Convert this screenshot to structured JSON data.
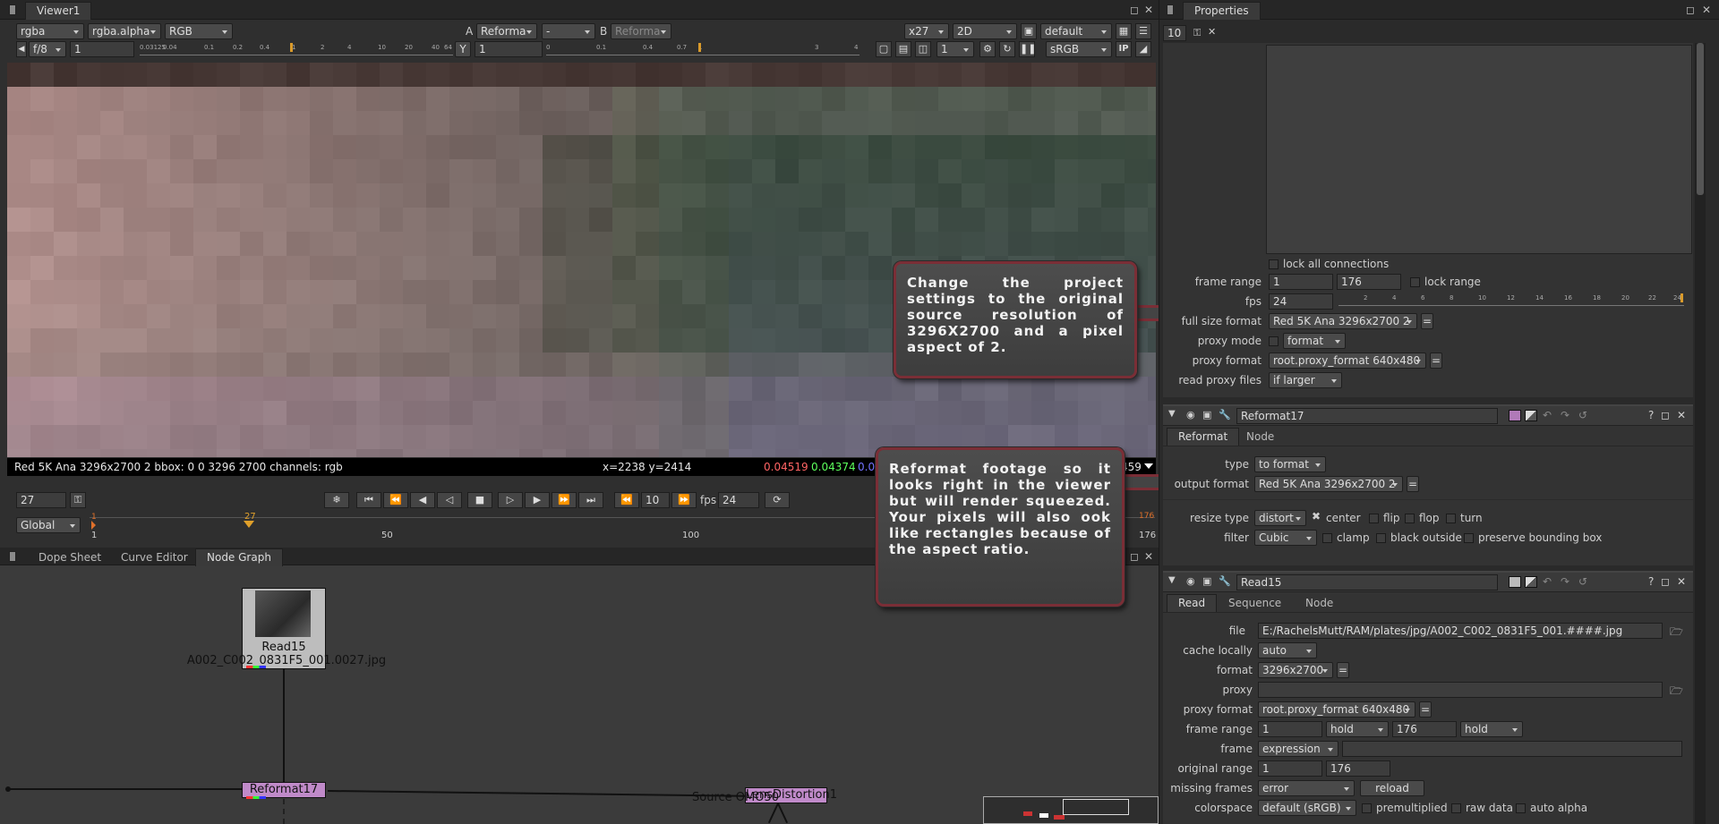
{
  "viewer": {
    "tab": "Viewer1",
    "channels": "rgba",
    "alpha": "rgba.alpha",
    "colorspace_mode": "RGB",
    "input_a_label": "A",
    "input_a": "Reforma",
    "input_a_op": "-",
    "input_b_label": "B",
    "input_b": "Reforma",
    "zoom": "x27",
    "view_mode": "2D",
    "lut_default": "default",
    "fstop": "f/8",
    "gain": "1",
    "gamma_label": "Y",
    "gamma": "1",
    "proxy_level": "1",
    "display": "sRGB",
    "ip_label": "IP",
    "gain_ticks": [
      "0.03125",
      "0.04",
      "0.1",
      "0.2",
      "0.4",
      "1",
      "2",
      "4",
      "10",
      "20",
      "40",
      "64"
    ],
    "gamma_ticks": [
      "0",
      "0.1",
      "0.4",
      "0.7",
      "1",
      "3",
      "4"
    ],
    "status_format": "Red 5K Ana 3296x2700 2  bbox: 0 0 3296 2700 channels: rgb",
    "status_coords": "x=2238 y=2414",
    "pixel_r": "0.04519",
    "pixel_g": "0.04374",
    "pixel_b": "0.05",
    "pixel_tail": "459",
    "colors": {
      "r": "#ff6464",
      "g": "#5dff5d",
      "b": "#7373ff"
    }
  },
  "timeline": {
    "frame": "27",
    "playback_step": "10",
    "fps_label": "fps",
    "fps": "24",
    "range_mode": "Global",
    "start_marker": "1",
    "current_marker": "27",
    "end_marker": "176",
    "ticks": [
      "1",
      "50",
      "100",
      "176"
    ]
  },
  "graph": {
    "tabs": [
      "Dope Sheet",
      "Curve Editor",
      "Node Graph"
    ],
    "read_node_title": "Read15",
    "read_node_file": "A002_C002_0831F5_001.0027.jpg",
    "reformat_node": "Reformat17",
    "lens_node": "LensDistortion1",
    "lens_overlay": "Source OMO50"
  },
  "callouts": {
    "project": "Change the project settings to the original source resolution of 3296X2700 and a pixel aspect of 2.",
    "reformat": "Reformat footage so it looks right in the viewer but will render squeezed. Your pixels will also ook like rectangles because of the aspect ratio."
  },
  "properties": {
    "tab": "Properties",
    "max_panels": "10",
    "project": {
      "lock_all": "lock all connections",
      "frame_range_label": "frame range",
      "frame_start": "1",
      "frame_end": "176",
      "lock_range": "lock range",
      "fps_label": "fps",
      "fps": "24",
      "fps_ticks": [
        "2",
        "4",
        "6",
        "8",
        "10",
        "12",
        "14",
        "16",
        "18",
        "20",
        "22",
        "24"
      ],
      "full_size_label": "full size format",
      "full_size": "Red 5K Ana 3296x2700 2",
      "proxy_mode_label": "proxy mode",
      "proxy_mode": "format",
      "proxy_format_label": "proxy format",
      "proxy_format": "root.proxy_format 640x480",
      "read_proxy_label": "read proxy files",
      "read_proxy": "if larger",
      "eq": "="
    },
    "reformat": {
      "name": "Reformat17",
      "tabs": [
        "Reformat",
        "Node"
      ],
      "type_label": "type",
      "type": "to format",
      "output_label": "output format",
      "output": "Red 5K Ana 3296x2700 2",
      "resize_label": "resize type",
      "resize": "distort",
      "center": "center",
      "flip": "flip",
      "flop": "flop",
      "turn": "turn",
      "filter_label": "filter",
      "filter": "Cubic",
      "clamp": "clamp",
      "black_outside": "black outside",
      "preserve_bbox": "preserve bounding box"
    },
    "read": {
      "name": "Read15",
      "tabs": [
        "Read",
        "Sequence",
        "Node"
      ],
      "file_label": "file",
      "file": "E:/RachelsMutt/RAM/plates/jpg/A002_C002_0831F5_001.####.jpg",
      "cache_label": "cache locally",
      "cache": "auto",
      "format_label": "format",
      "format": "3296x2700",
      "proxy_label": "proxy",
      "proxy_format_label": "proxy format",
      "proxy_format": "root.proxy_format 640x480",
      "frame_range_label": "frame range",
      "first": "1",
      "before": "hold",
      "last": "176",
      "after": "hold",
      "frame_label": "frame",
      "frame_mode": "expression",
      "orig_range_label": "original range",
      "orig_first": "1",
      "orig_last": "176",
      "missing_label": "missing frames",
      "missing": "error",
      "reload": "reload",
      "colorspace_label": "colorspace",
      "colorspace": "default (sRGB)",
      "premultiplied": "premultiplied",
      "raw_data": "raw data",
      "auto_alpha": "auto alpha"
    }
  }
}
